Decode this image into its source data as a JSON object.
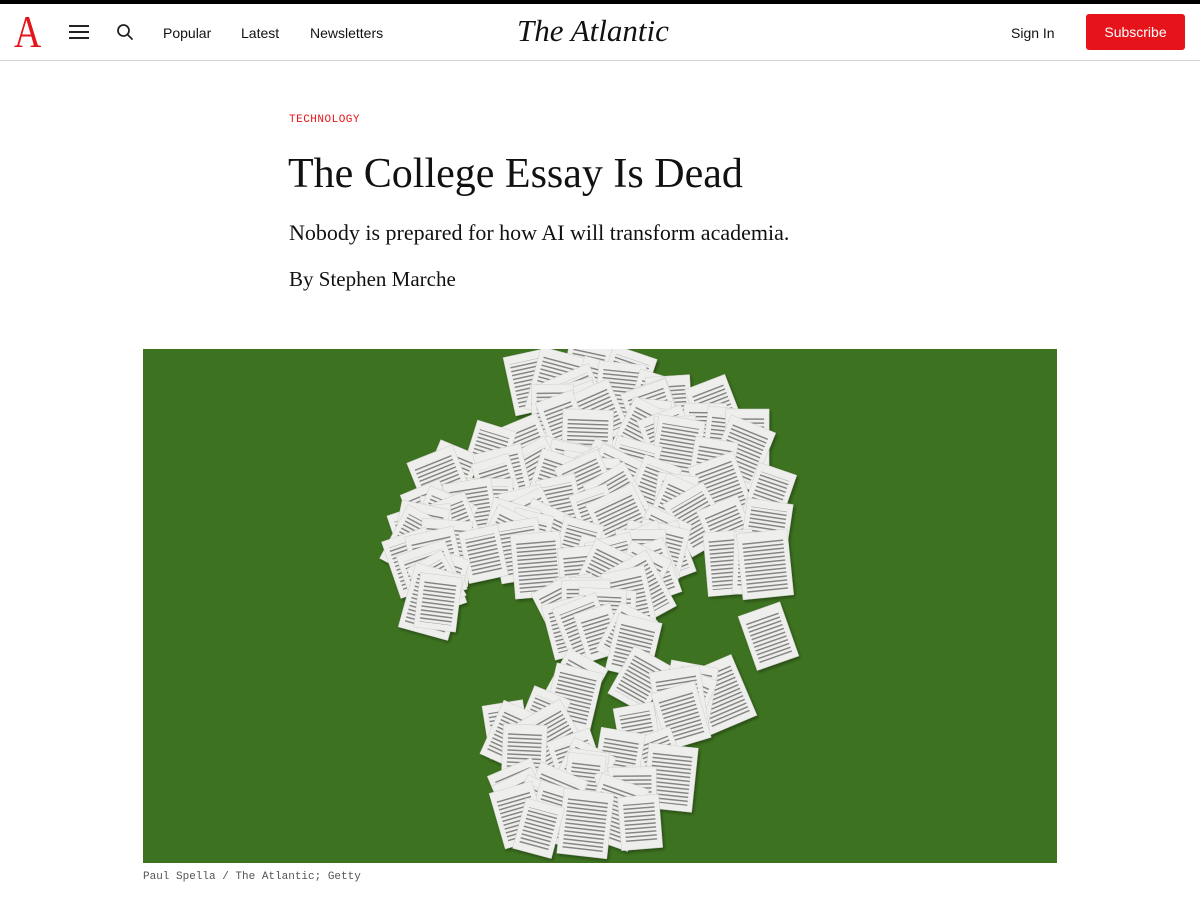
{
  "header": {
    "logo_letter": "A",
    "wordmark": "The Atlantic",
    "nav": [
      {
        "label": "Popular"
      },
      {
        "label": "Latest"
      },
      {
        "label": "Newsletters"
      }
    ],
    "sign_in_label": "Sign In",
    "subscribe_label": "Subscribe"
  },
  "article": {
    "section": "TECHNOLOGY",
    "headline": "The College Essay Is Dead",
    "dek": "Nobody is prepared for how AI will transform academia.",
    "byline_prefix": "By",
    "author": "Stephen Marche"
  },
  "lead_image": {
    "caption": "Paul Spella / The Atlantic; Getty"
  },
  "colors": {
    "brand_red": "#e7131a",
    "image_background": "#3d7320",
    "paper": "#eeeeec"
  },
  "icons": [
    "menu-icon",
    "search-icon"
  ]
}
